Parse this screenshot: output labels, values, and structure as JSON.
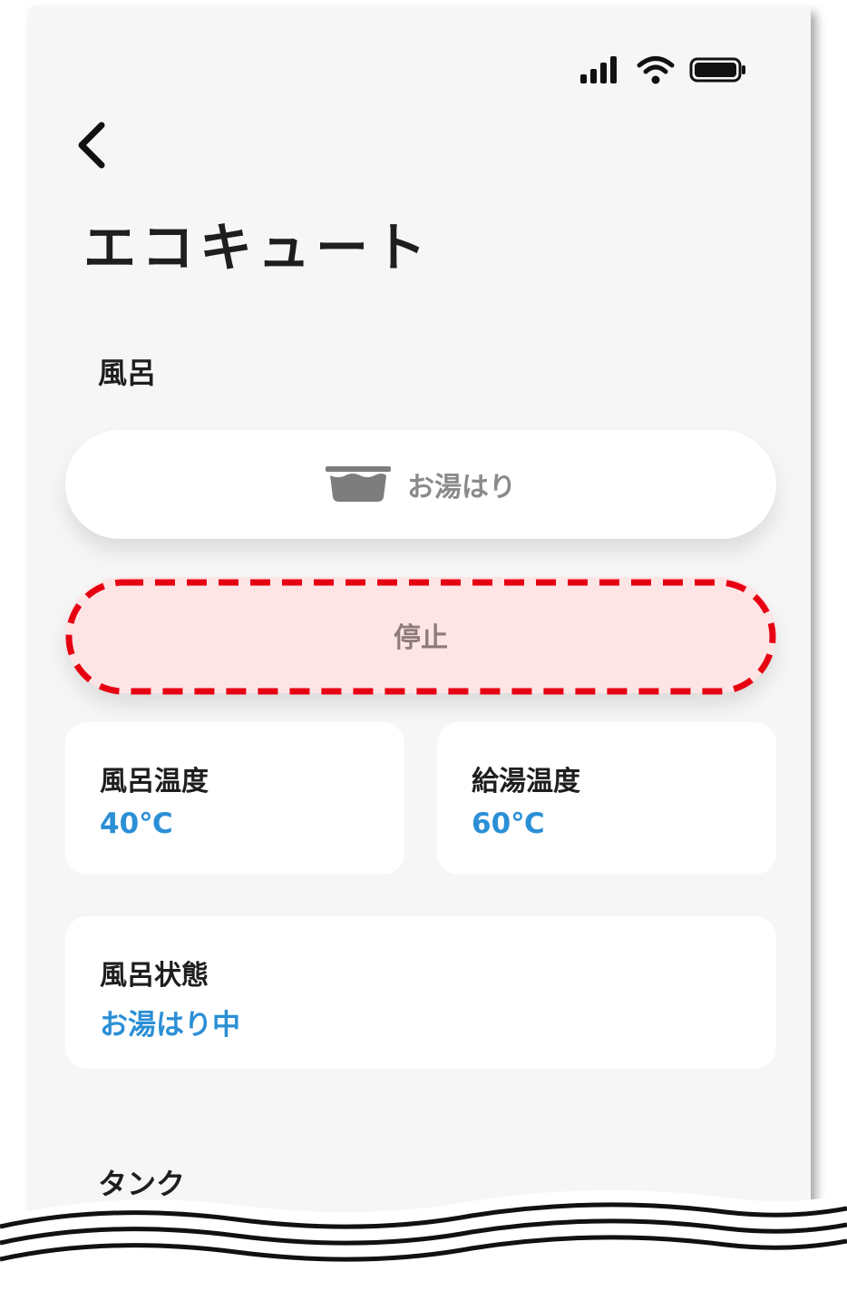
{
  "header": {
    "title": "エコキュート",
    "back": {
      "icon": "chevron-left-icon"
    }
  },
  "status_bar": {
    "icons": [
      "signal-icon",
      "wifi-icon",
      "battery-icon"
    ]
  },
  "bath": {
    "section_label": "風呂",
    "fill_button": {
      "label": "お湯はり",
      "icon": "bathtub-icon"
    },
    "stop_button": {
      "label": "停止",
      "highlight": "dashed-red-outline"
    }
  },
  "cards": {
    "bath_temp": {
      "title": "風呂温度",
      "value": "40℃"
    },
    "supply_temp": {
      "title": "給湯温度",
      "value": "60℃"
    },
    "bath_status": {
      "title": "風呂状態",
      "value": "お湯はり中"
    }
  },
  "tank": {
    "section_label": "タンク"
  },
  "colors": {
    "background": "#f6f6f6",
    "card": "#ffffff",
    "accent_blue": "#2b8fd6",
    "stop_fill": "#fde5e6",
    "highlight_red": "#e60012"
  }
}
